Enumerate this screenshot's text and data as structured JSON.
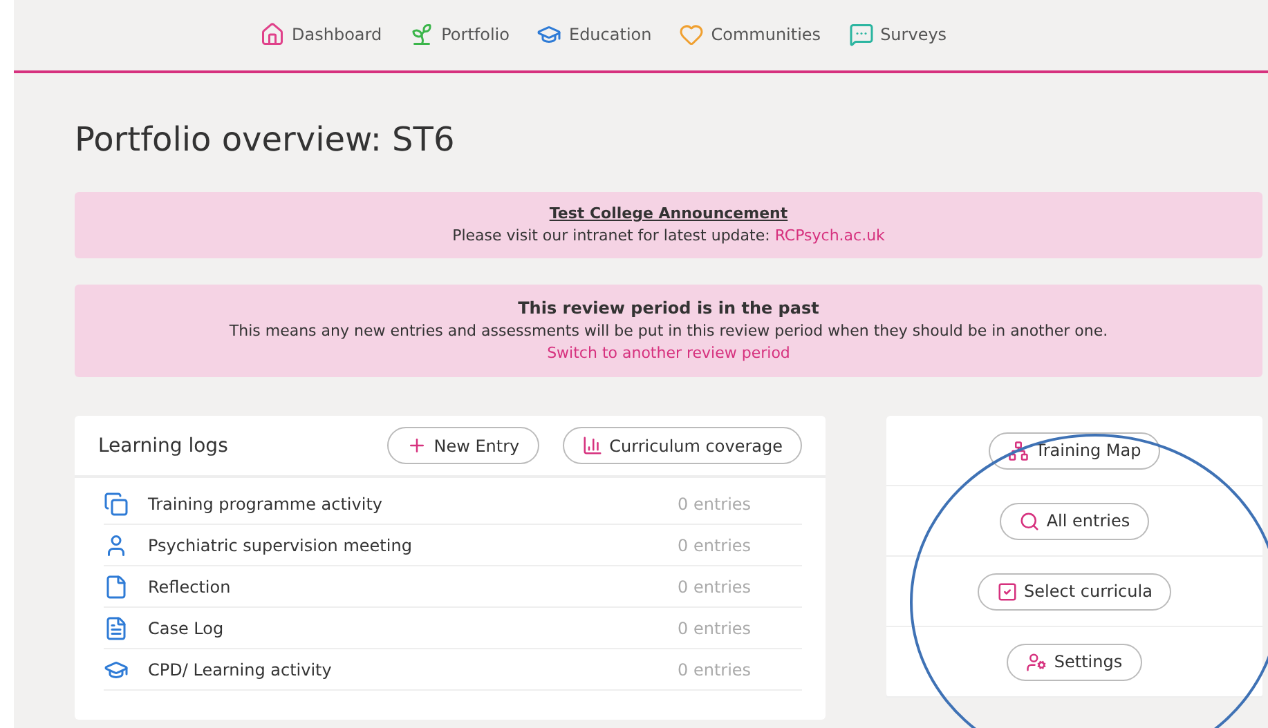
{
  "nav": [
    {
      "label": "Dashboard"
    },
    {
      "label": "Portfolio"
    },
    {
      "label": "Education"
    },
    {
      "label": "Communities"
    },
    {
      "label": "Surveys"
    }
  ],
  "title": "Portfolio overview: ST6",
  "announcement": {
    "heading": "Test College Announcement",
    "text": "Please visit our intranet for latest update: ",
    "link": "RCPsych.ac.uk"
  },
  "review_notice": {
    "heading": "This review period is in the past",
    "text": "This means any new entries and assessments will be put in this review period when they should be in another one.",
    "link": "Switch to another review period"
  },
  "learning_logs": {
    "title": "Learning logs",
    "buttons": [
      "New Entry",
      "Curriculum coverage"
    ],
    "rows": [
      {
        "name": "Training programme activity",
        "count": "0 entries"
      },
      {
        "name": "Psychiatric supervision meeting",
        "count": "0 entries"
      },
      {
        "name": "Reflection",
        "count": "0 entries"
      },
      {
        "name": "Case Log",
        "count": "0 entries"
      },
      {
        "name": "CPD/ Learning activity",
        "count": "0 entries"
      }
    ]
  },
  "actions": [
    {
      "label": "Training Map"
    },
    {
      "label": "All entries"
    },
    {
      "label": "Select curricula"
    },
    {
      "label": "Settings"
    }
  ]
}
